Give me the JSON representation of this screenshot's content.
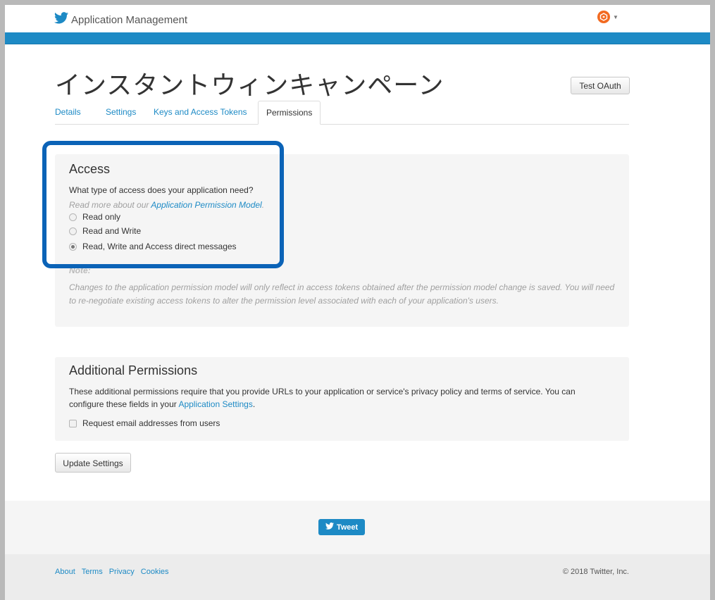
{
  "header": {
    "brand_icon": "twitter-bird-icon",
    "title": "Application Management",
    "user_menu_icon": "avatar-hexagon-icon"
  },
  "app": {
    "name": "インスタントウィンキャンペーン",
    "test_oauth_label": "Test OAuth"
  },
  "tabs": [
    {
      "label": "Details",
      "active": false
    },
    {
      "label": "Settings",
      "active": false
    },
    {
      "label": "Keys and Access Tokens",
      "active": false
    },
    {
      "label": "Permissions",
      "active": true
    }
  ],
  "access": {
    "heading": "Access",
    "question": "What type of access does your application need?",
    "read_more_prefix": "Read more about our ",
    "read_more_link": "Application Permission Model",
    "read_more_suffix": ".",
    "options": [
      {
        "label": "Read only",
        "selected": false
      },
      {
        "label": "Read and Write",
        "selected": false
      },
      {
        "label": "Read, Write and Access direct messages",
        "selected": true
      }
    ],
    "note_heading": "Note:",
    "note_body": "Changes to the application permission model will only reflect in access tokens obtained after the permission model change is saved. You will need to re-negotiate existing access tokens to alter the permission level associated with each of your application's users."
  },
  "additional": {
    "heading": "Additional Permissions",
    "description_line1": "These additional permissions require that you provide URLs to your application or service's privacy policy and terms of service. You can",
    "description_line2_prefix": "configure these fields in your ",
    "description_link": "Application Settings",
    "description_line2_suffix": ".",
    "checkbox_label": "Request email addresses from users",
    "checkbox_checked": false
  },
  "actions": {
    "update_label": "Update Settings"
  },
  "share": {
    "tweet_label": "Tweet"
  },
  "footer": {
    "links": [
      "About",
      "Terms",
      "Privacy",
      "Cookies"
    ],
    "copyright": "© 2018 Twitter, Inc."
  },
  "colors": {
    "accent": "#1d8ac5",
    "highlight_border": "#0b63b7",
    "avatar": "#f26a21"
  }
}
